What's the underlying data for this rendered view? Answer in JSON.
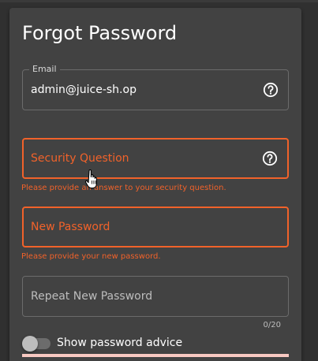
{
  "form": {
    "title": "Forgot Password",
    "email": {
      "label": "Email",
      "value": "admin@juice-sh.op",
      "help_icon": "help-circle-icon"
    },
    "security_question": {
      "placeholder": "Security Question",
      "help_icon": "help-circle-icon",
      "error": "Please provide an answer to your security question."
    },
    "new_password": {
      "placeholder": "New Password",
      "error": "Please provide your new password."
    },
    "repeat_password": {
      "placeholder": "Repeat New Password",
      "counter": "0/20"
    },
    "password_advice_toggle": {
      "label": "Show password advice",
      "checked": false
    }
  },
  "colors": {
    "background": "#303030",
    "card": "#424242",
    "error": "#f1622a",
    "strength_bar": "#f8c9c2"
  }
}
